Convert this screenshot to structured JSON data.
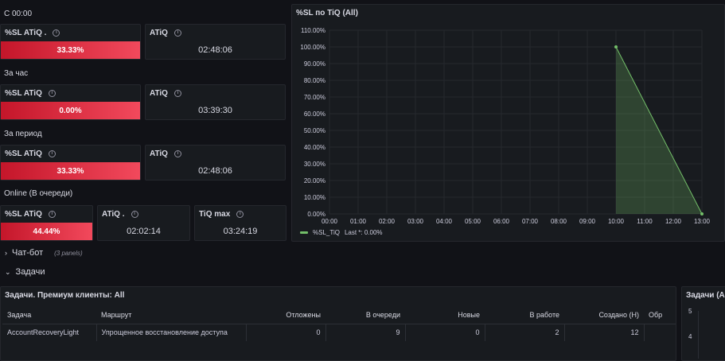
{
  "sections": {
    "since_midnight": "С 00:00",
    "last_hour": "За час",
    "period": "За период",
    "online": "Online (В очереди)"
  },
  "stats": {
    "sl_1": {
      "title": "%SL ATiQ .",
      "value": "33.33%"
    },
    "atiq_1": {
      "title": "ATiQ",
      "value": "02:48:06"
    },
    "sl_2": {
      "title": "%SL ATiQ",
      "value": "0.00%"
    },
    "atiq_2": {
      "title": "ATiQ",
      "value": "03:39:30"
    },
    "sl_3": {
      "title": "%SL ATiQ",
      "value": "33.33%"
    },
    "atiq_3": {
      "title": "ATiQ",
      "value": "02:48:06"
    },
    "sl_4": {
      "title": "%SL ATiQ",
      "value": "44.44%"
    },
    "atiq_4": {
      "title": "ATiQ .",
      "value": "02:02:14"
    },
    "tiq_max": {
      "title": "TiQ max",
      "value": "03:24:19"
    }
  },
  "chart_panel": {
    "title": "%SL по TiQ (All)",
    "legend_label": "%SL_TiQ",
    "legend_last": "Last *: 0.00%"
  },
  "chart_data": {
    "type": "area",
    "x_ticks": [
      "00:00",
      "01:00",
      "02:00",
      "03:00",
      "04:00",
      "05:00",
      "06:00",
      "07:00",
      "08:00",
      "09:00",
      "10:00",
      "11:00",
      "12:00",
      "13:00"
    ],
    "y_ticks": [
      "0.00%",
      "10.00%",
      "20.00%",
      "30.00%",
      "40.00%",
      "50.00%",
      "60.00%",
      "70.00%",
      "80.00%",
      "90.00%",
      "100.00%",
      "110.00%"
    ],
    "ylim": [
      0,
      110
    ],
    "series": [
      {
        "name": "%SL_TiQ",
        "x": [
          10,
          13
        ],
        "values": [
          100,
          0
        ]
      }
    ],
    "colors": {
      "line": "#73bf69",
      "fill": "#73bf69"
    }
  },
  "rows": {
    "chatbot": {
      "label": "Чат-бот",
      "note": "(3 panels)"
    },
    "tasks": {
      "label": "Задачи"
    }
  },
  "table_panel": {
    "title": "Задачи. Премиум клиенты: All",
    "columns": [
      "Задача",
      "Маршрут",
      "Отложены",
      "В очереди",
      "Новые",
      "В работе",
      "Создано (Н)",
      "Обр"
    ],
    "rows": [
      [
        "AccountRecoveryLight",
        "Упрощенное восстановление доступа",
        "0",
        "9",
        "0",
        "2",
        "12",
        ""
      ]
    ]
  },
  "side_panel": {
    "title": "Задачи (All",
    "ticks": [
      "5",
      "4"
    ]
  },
  "colors": {
    "accent_red": "#f2495c",
    "series_green": "#73bf69",
    "background": "#111217",
    "panel": "#181b1f"
  }
}
